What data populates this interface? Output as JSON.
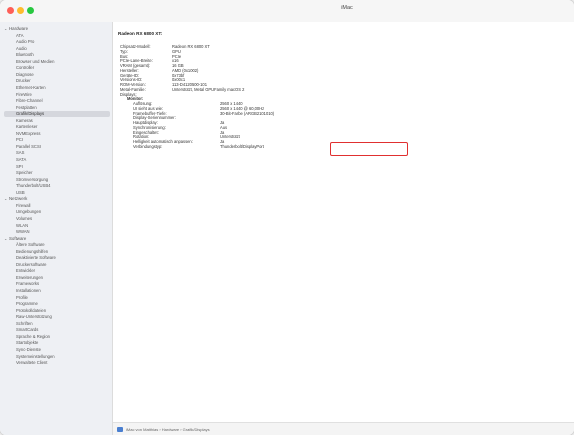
{
  "window": {
    "title": "iMac"
  },
  "sidebar": {
    "hardware": {
      "label": "Hardware",
      "items": [
        "ATA",
        "Audio Pro",
        "Audio",
        "Bluetooth",
        "Browser und Medien",
        "Controller",
        "Diagnose",
        "Drucker",
        "Ethernet-Karten",
        "FireWire",
        "Fibre-Channel",
        "Festplatten",
        "Grafik/Displays",
        "Kameras",
        "Kartenleser",
        "NVMExpress",
        "PCI",
        "Parallel SCSI",
        "SAS",
        "SATA",
        "SPI",
        "Speicher",
        "Stromversorgung",
        "Thunderbolt/USB4",
        "USB"
      ],
      "selected_index": 12
    },
    "network": {
      "label": "Netzwerk",
      "items": [
        "Firewall",
        "Umgebungen",
        "Volumes",
        "WLAN",
        "WWAN"
      ]
    },
    "software": {
      "label": "Software",
      "items": [
        "Ältere Software",
        "Bedienungshilfen",
        "Deaktivierte Software",
        "Druckersoftware",
        "Entwickler",
        "Erweiterungen",
        "Frameworks",
        "Installationen",
        "Profile",
        "Programme",
        "Protokolldateien",
        "Raw-Unterstützung",
        "Schriften",
        "SmartCards",
        "Sprache & Region",
        "Startobjekte",
        "Sync-Dienste",
        "Systemeinstellungen",
        "Verwaltete Client"
      ]
    }
  },
  "main": {
    "device_title": "Radeon RX 6800 XT:",
    "rows": [
      {
        "k": "Chipsatz-Modell:",
        "v": "Radeon RX 6800 XT"
      },
      {
        "k": "Typ:",
        "v": "GPU"
      },
      {
        "k": "Bus:",
        "v": "PCIe"
      },
      {
        "k": "PCIe-Lane-Breite:",
        "v": "x16"
      },
      {
        "k": "VRAM (gesamt):",
        "v": "16 GB"
      },
      {
        "k": "Hersteller:",
        "v": "AMD (0x1002)"
      },
      {
        "k": "Geräte-ID:",
        "v": "0x73bf"
      },
      {
        "k": "Versions-ID:",
        "v": "0x00c1"
      },
      {
        "k": "ROM-Version:",
        "v": "113-D4120500-101"
      },
      {
        "k": "Metal-Familie:",
        "v": "Unterstützt, Metal GPUFamily macOS 2"
      },
      {
        "k": "Displays:",
        "v": ""
      }
    ],
    "display_name": "Monitor:",
    "display_rows": [
      {
        "k": "Auflösung:",
        "v": "2560 x 1440"
      },
      {
        "k": "UI sieht aus wie:",
        "v": "2560 x 1440 @ 60,00Hz"
      },
      {
        "k": "Framebuffer-Tiefe:",
        "v": "30-Bit-Farbe (ARGB2101010)"
      },
      {
        "k": "Display-Seriennummer:",
        "v": ""
      },
      {
        "k": "Hauptdisplay:",
        "v": "Ja"
      },
      {
        "k": "Synchronisierung:",
        "v": "Aus"
      },
      {
        "k": "Eingeschaltet:",
        "v": "Ja"
      },
      {
        "k": "Rotation:",
        "v": "Unterstützt"
      },
      {
        "k": "Helligkeit automatisch anpassen:",
        "v": "Ja"
      },
      {
        "k": "Verbindungstyp:",
        "v": "Thunderbolt/DisplayPort"
      }
    ]
  },
  "statusbar": {
    "path": "iMac von Matthias › Hardware › Grafik/Displays"
  }
}
